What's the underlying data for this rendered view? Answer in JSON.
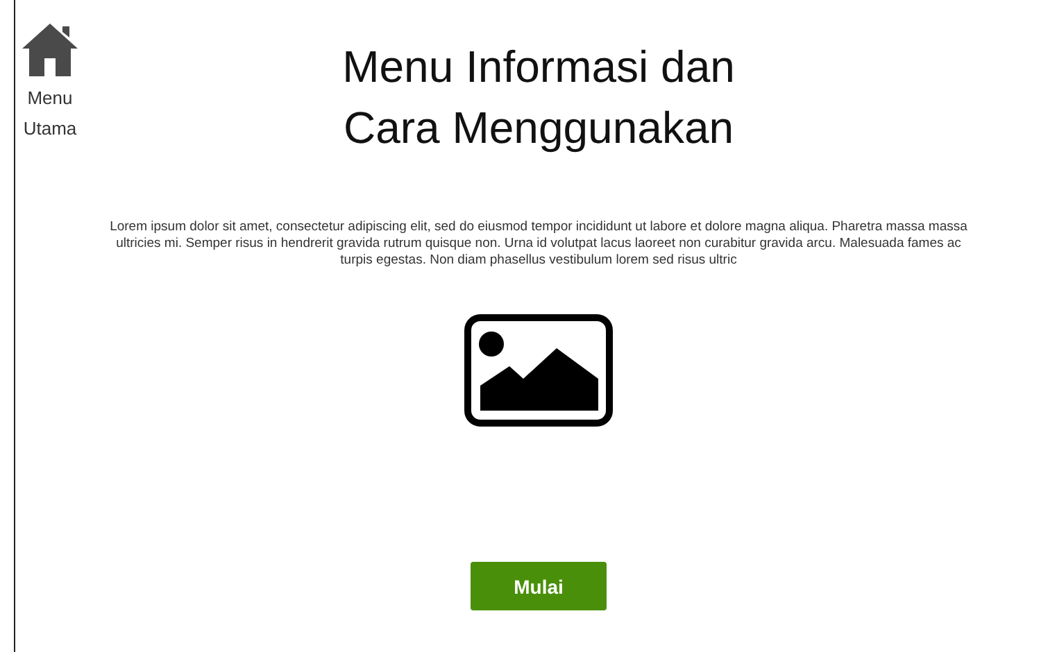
{
  "nav": {
    "label": "Menu\nUtama"
  },
  "title": "Menu Informasi dan\nCara Menggunakan",
  "description": "Lorem ipsum dolor sit amet, consectetur adipiscing elit, sed do eiusmod tempor incididunt ut labore et dolore magna aliqua. Pharetra massa massa ultricies mi. Semper risus in hendrerit gravida rutrum quisque non. Urna id volutpat lacus laoreet non curabitur gravida arcu. Malesuada fames ac turpis egestas. Non diam phasellus vestibulum lorem sed risus ultric",
  "start_button": {
    "label": "Mulai"
  }
}
